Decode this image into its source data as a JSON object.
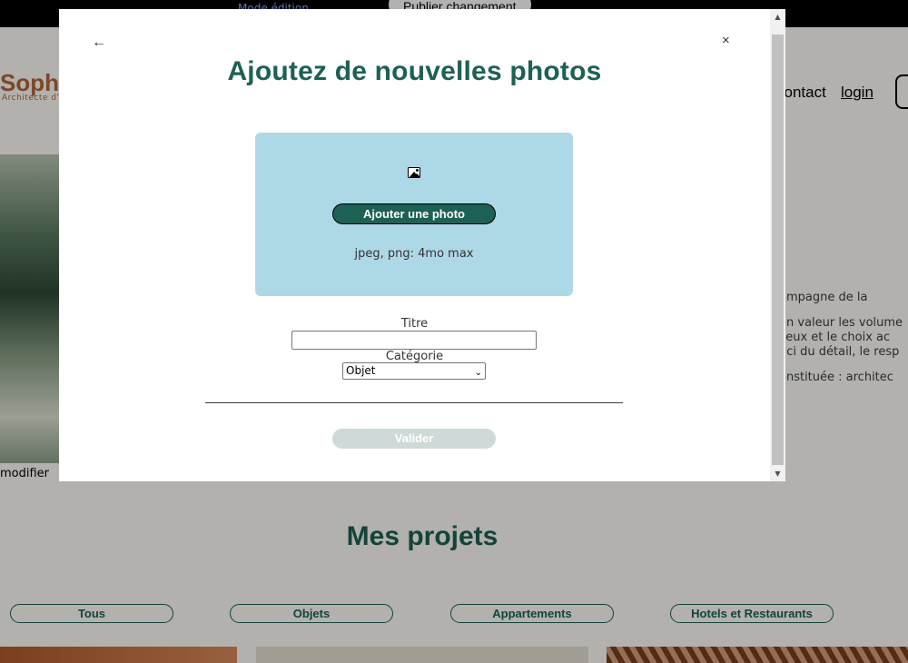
{
  "edit_bar": {
    "edit_mode_label": "Mode édition",
    "publish_label": "Publier changement"
  },
  "header": {
    "logo": "Sophie Bluel",
    "logo_sub": "Architecte d'intérieur",
    "nav": {
      "contact": "contact",
      "login": "login"
    }
  },
  "intro": {
    "modifier_label": "modifier",
    "about_lines": [
      "ompagne de la",
      "en valeur les volume",
      "lieux et le choix ac",
      "uci du détail, le resp",
      "onstituée : architec"
    ]
  },
  "portfolio": {
    "title": "Mes projets",
    "filters": [
      "Tous",
      "Objets",
      "Appartements",
      "Hotels et Restaurants"
    ]
  },
  "modal": {
    "back_icon": "←",
    "close_icon": "×",
    "title": "Ajoutez de nouvelles photos",
    "add_photo_label": "Ajouter une photo",
    "upload_hint": "jpeg, png: 4mo max",
    "title_field_label": "Titre",
    "title_field_value": "",
    "category_field_label": "Catégorie",
    "category_selected": "Objet",
    "validate_label": "Valider"
  },
  "colors": {
    "brand_green": "#1d6154",
    "upload_zone": "#add8e6",
    "validate_disabled": "#cfd9d7"
  }
}
